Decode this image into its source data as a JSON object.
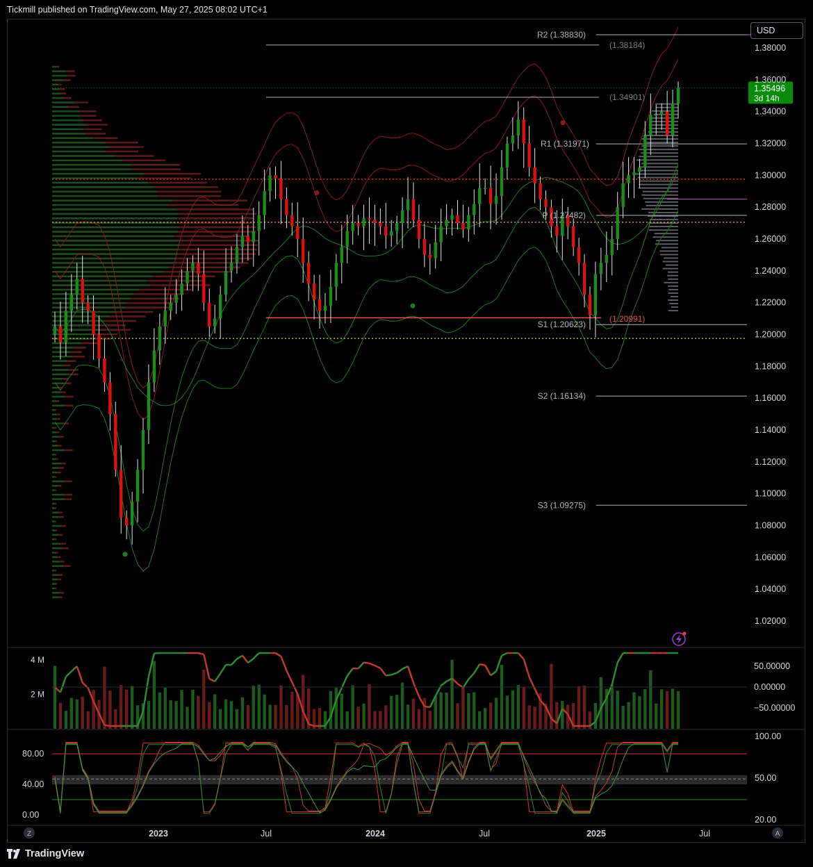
{
  "header": {
    "published": "Tickmill published on TradingView.com, May 27, 2025 08:02 UTC+1"
  },
  "toolbar": {
    "currency": "USD"
  },
  "footer": {
    "brand": "TradingView",
    "logo_icon": "tradingview-logo-icon"
  },
  "price_axis": {
    "ticks": [
      "1.38000",
      "1.36000",
      "1.34000",
      "1.32000",
      "1.30000",
      "1.28000",
      "1.26000",
      "1.24000",
      "1.22000",
      "1.20000",
      "1.18000",
      "1.16000",
      "1.14000",
      "1.12000",
      "1.10000",
      "1.08000",
      "1.06000",
      "1.04000",
      "1.02000"
    ]
  },
  "last_price": {
    "value": "1.35496",
    "countdown": "3d 14h",
    "color": "#0a8a0a"
  },
  "levels": {
    "r2": "R2 (1.38830)",
    "r2_alt": "(1.38184)",
    "r1": "R1 (1.31971)",
    "r1_alt": "(1.34901)",
    "p": "P (1.27482)",
    "s1": "S1 (1.20623)",
    "s1_alt": "(1.20991)",
    "s2": "S2 (1.16134)",
    "s3": "S3 (1.09275)"
  },
  "volume_axis": {
    "ticks": [
      "4 M",
      "2 M"
    ]
  },
  "oscillator_axis": {
    "ticks": [
      "50.00000",
      "0.00000",
      "−50.00000"
    ]
  },
  "stoch_axis": {
    "left_ticks": [
      "80.00",
      "40.00",
      "0.00"
    ],
    "right_ticks": [
      "100.00",
      "50.00",
      "20.00"
    ]
  },
  "time_axis": {
    "labels": [
      "2023",
      "Jul",
      "2024",
      "Jul",
      "2025",
      "Jul"
    ],
    "corner_left": "Z",
    "corner_right": "A"
  },
  "colors": {
    "up": "#089981",
    "up_fill": "#1c8c1c",
    "down": "#e01010",
    "accent_green": "#0a8a0a",
    "accent_red": "#c0392b"
  },
  "chart_data": {
    "type": "candlestick",
    "title": "",
    "y_range": [
      1.01,
      1.395
    ],
    "date_range": [
      "2022-05-30",
      "2025-05-26"
    ],
    "interval": "1W",
    "last_close": 1.35496,
    "pivot_levels": {
      "R2": 1.3883,
      "R1": 1.31971,
      "P": 1.27482,
      "S1": 1.20623,
      "S2": 1.16134,
      "S3": 1.09275
    },
    "prior_pivots": {
      "R2": 1.38184,
      "R1": 1.34901,
      "S1": 1.20991
    },
    "horizontal_lines": [
      1.2975,
      1.2705,
      1.1975
    ],
    "approx_closes": [
      1.205,
      1.195,
      1.215,
      1.225,
      1.235,
      1.22,
      1.215,
      1.2,
      1.185,
      1.17,
      1.15,
      1.115,
      1.085,
      1.08,
      1.095,
      1.115,
      1.14,
      1.17,
      1.19,
      1.205,
      1.215,
      1.22,
      1.225,
      1.232,
      1.24,
      1.245,
      1.238,
      1.22,
      1.205,
      1.21,
      1.225,
      1.24,
      1.245,
      1.255,
      1.262,
      1.258,
      1.265,
      1.275,
      1.29,
      1.3,
      1.298,
      1.285,
      1.275,
      1.268,
      1.26,
      1.245,
      1.232,
      1.222,
      1.215,
      1.218,
      1.23,
      1.245,
      1.255,
      1.265,
      1.27,
      1.268,
      1.273,
      1.272,
      1.27,
      1.268,
      1.262,
      1.265,
      1.27,
      1.278,
      1.285,
      1.272,
      1.26,
      1.25,
      1.248,
      1.258,
      1.268,
      1.272,
      1.275,
      1.27,
      1.266,
      1.275,
      1.282,
      1.292,
      1.292,
      1.282,
      1.287,
      1.305,
      1.32,
      1.325,
      1.335,
      1.32,
      1.305,
      1.295,
      1.285,
      1.28,
      1.268,
      1.262,
      1.275,
      1.268,
      1.255,
      1.245,
      1.225,
      1.212,
      1.238,
      1.245,
      1.25,
      1.26,
      1.28,
      1.295,
      1.3,
      1.302,
      1.305,
      1.325,
      1.338,
      1.338,
      1.34,
      1.325,
      1.345,
      1.355
    ],
    "volume_millions_range": [
      0,
      4.4
    ],
    "stochastic_range": [
      0,
      100
    ]
  }
}
